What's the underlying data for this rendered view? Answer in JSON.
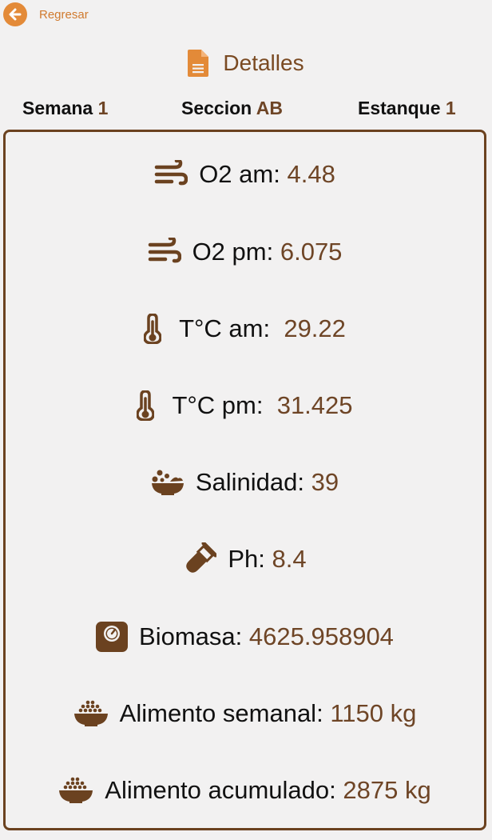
{
  "header": {
    "back_label": "Regresar",
    "title": "Detalles"
  },
  "meta": {
    "week_label": "Semana",
    "week_value": "1",
    "section_label": "Seccion",
    "section_value": "AB",
    "pond_label": "Estanque",
    "pond_value": "1"
  },
  "details": {
    "o2_am_label": "O2 am:",
    "o2_am_value": "4.48",
    "o2_pm_label": "O2 pm:",
    "o2_pm_value": "6.075",
    "temp_am_label": "T°C am:",
    "temp_am_value": "29.22",
    "temp_pm_label": "T°C pm:",
    "temp_pm_value": "31.425",
    "salinity_label": "Salinidad:",
    "salinity_value": "39",
    "ph_label": "Ph:",
    "ph_value": "8.4",
    "biomass_label": "Biomasa:",
    "biomass_value": "4625.958904",
    "weekly_feed_label": "Alimento semanal:",
    "weekly_feed_value": "1150 kg",
    "cumulative_feed_label": "Alimento acumulado:",
    "cumulative_feed_value": "2875 kg"
  },
  "colors": {
    "accent_orange": "#e38a38",
    "brown": "#6b4220",
    "value_brown": "#6e4526",
    "background": "#f2f1f1"
  },
  "icons": [
    "arrow-left-icon",
    "document-icon",
    "wind-icon",
    "thermometer-icon",
    "bowl-icon",
    "test-tube-icon",
    "scale-icon",
    "feed-bowl-icon"
  ]
}
